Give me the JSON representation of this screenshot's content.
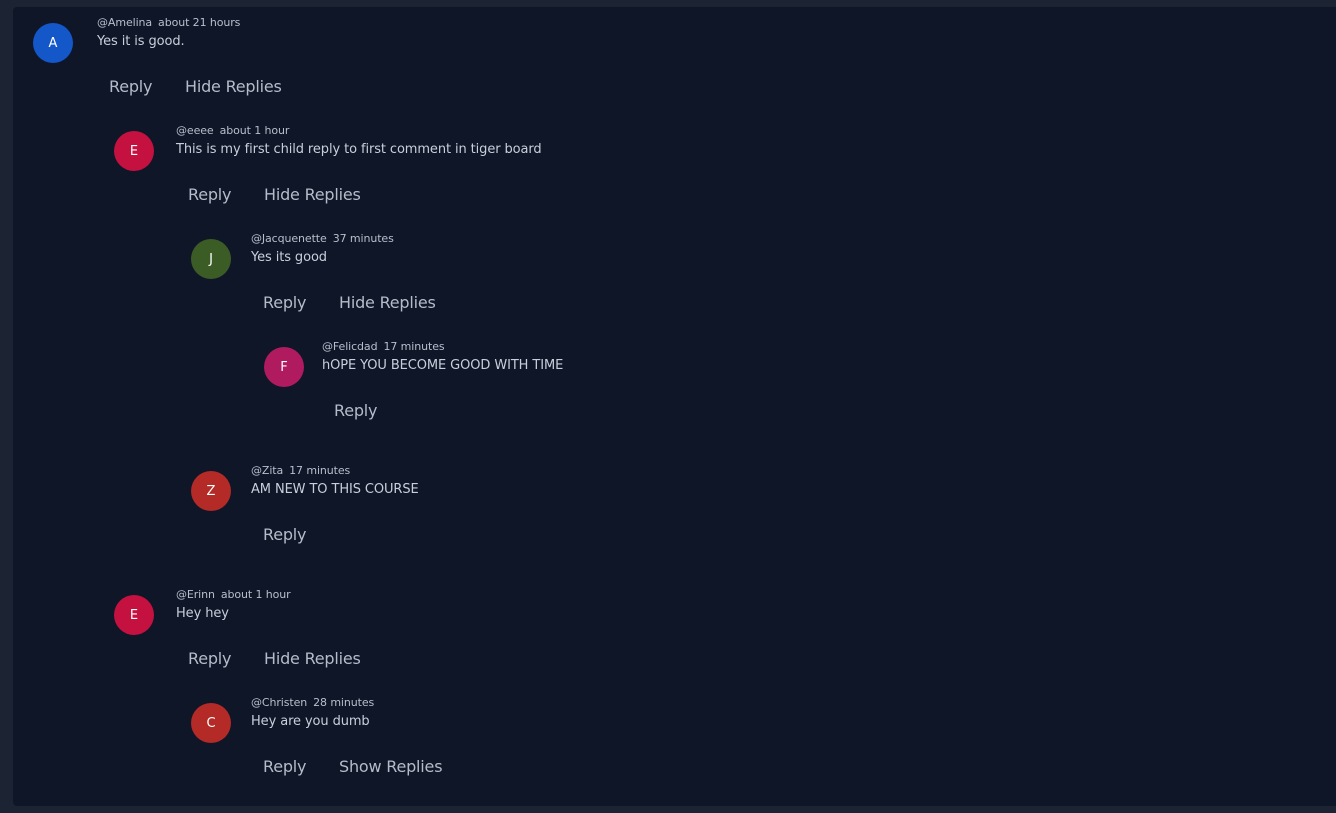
{
  "labels": {
    "reply": "Reply",
    "hide_replies": "Hide Replies",
    "show_replies": "Show Replies"
  },
  "comments": [
    {
      "username": "@Amelina",
      "time": "about 21 hours",
      "text": "Yes it is good.",
      "avatar_letter": "A",
      "avatar_color": "#1457c9"
    },
    {
      "username": "@eeee",
      "time": "about 1 hour",
      "text": "This is my first child reply to first comment in tiger board",
      "avatar_letter": "E",
      "avatar_color": "#c4113f"
    },
    {
      "username": "@Jacquenette",
      "time": "37 minutes",
      "text": "Yes its good",
      "avatar_letter": "J",
      "avatar_color": "#3c5c26"
    },
    {
      "username": "@Felicdad",
      "time": "17 minutes",
      "text": "hOPE YOU BECOME GOOD WITH TIME",
      "avatar_letter": "F",
      "avatar_color": "#b01a5f"
    },
    {
      "username": "@Zita",
      "time": "17 minutes",
      "text": "AM NEW TO THIS COURSE",
      "avatar_letter": "Z",
      "avatar_color": "#b32a26"
    },
    {
      "username": "@Erinn",
      "time": "about 1 hour",
      "text": "Hey hey",
      "avatar_letter": "E",
      "avatar_color": "#c4113f"
    },
    {
      "username": "@Christen",
      "time": "28 minutes",
      "text": "Hey are you dumb",
      "avatar_letter": "C",
      "avatar_color": "#b32a26"
    }
  ]
}
